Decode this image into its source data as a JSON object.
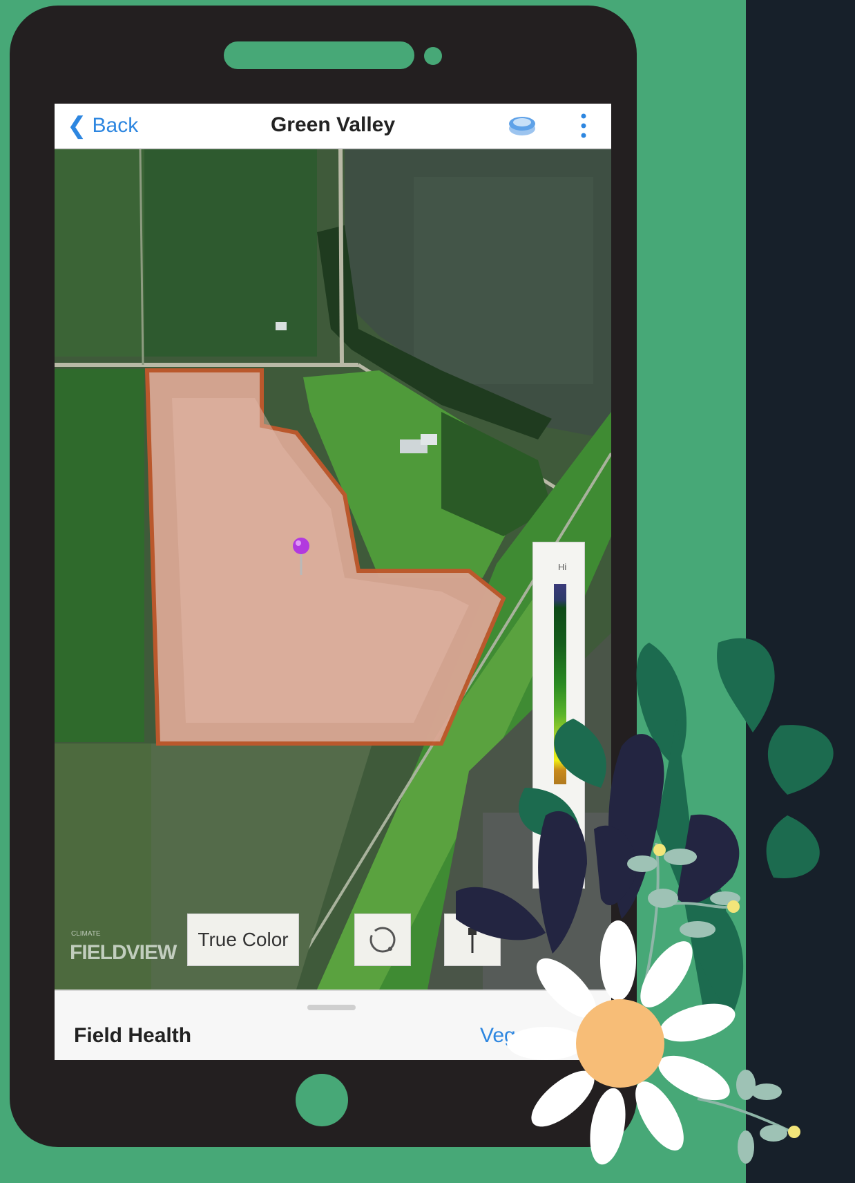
{
  "header": {
    "back_label": "Back",
    "title": "Green Valley",
    "layers_icon": "layers-icon",
    "more_icon": "more-vertical-icon"
  },
  "map": {
    "watermark": "FIELDVIEW",
    "pin_icon": "map-pin-icon"
  },
  "map_controls": {
    "true_color_label": "True Color",
    "circle_tool_icon": "lasso-icon",
    "pin_tool_icon": "pin-drop-icon"
  },
  "legend": {
    "label": "Hi",
    "gradient": [
      "#3a3a7a",
      "#0e4a18",
      "#2a8a22",
      "#59b32a",
      "#f0ef15",
      "#b07a1e"
    ]
  },
  "bottom_sheet": {
    "title": "Field Health",
    "link": "Vegeta"
  },
  "colors": {
    "background": "#47a877",
    "phone": "#231f20",
    "dark_strip": "#17202a",
    "accent_blue": "#2d86e0",
    "pin": "#b23adf"
  }
}
